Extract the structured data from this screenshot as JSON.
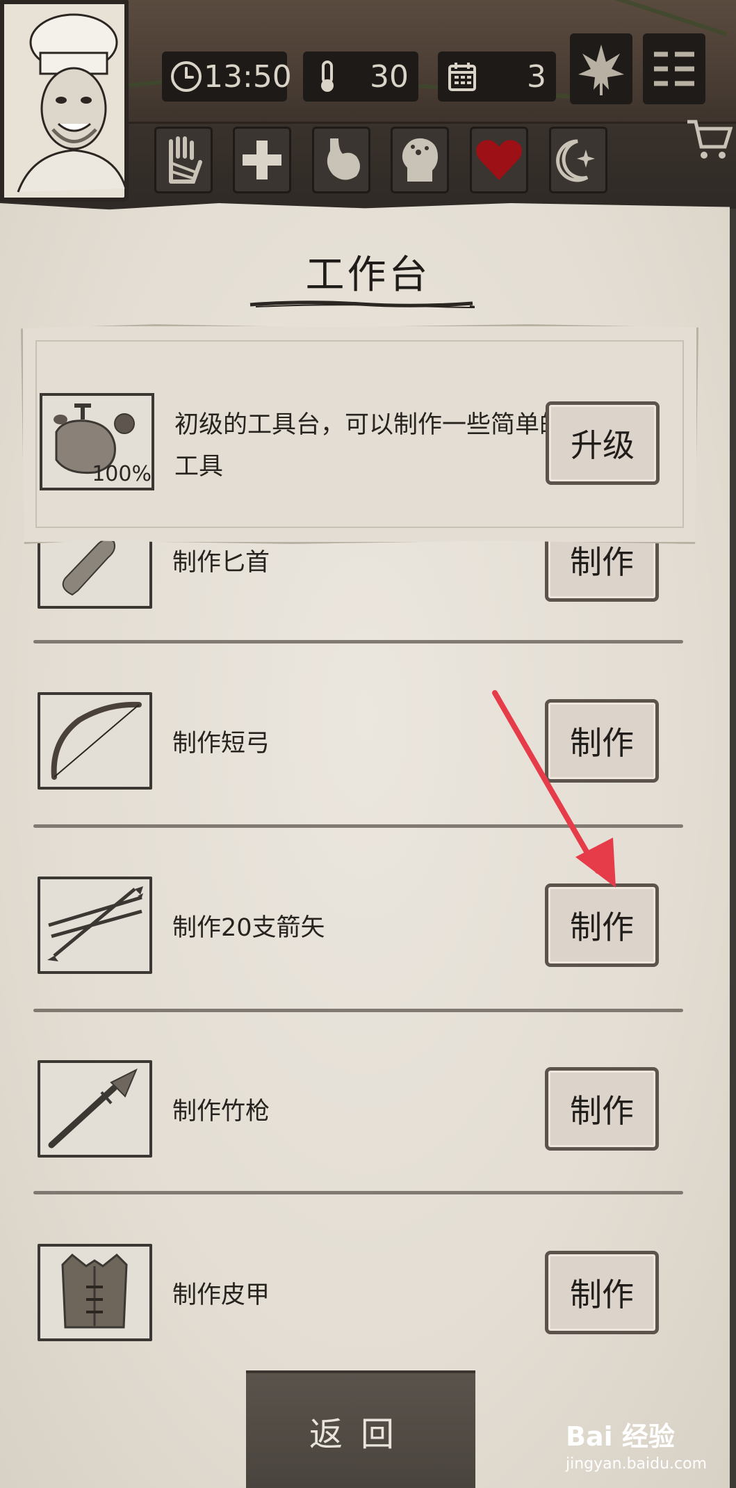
{
  "status": {
    "time": "13:50",
    "temperature": "30",
    "day": "3"
  },
  "icons": {
    "clock": "clock-icon",
    "thermometer": "thermometer-icon",
    "calendar": "calendar-icon",
    "leaf": "leaf-icon",
    "menu": "menu-icon",
    "cart": "cart-icon"
  },
  "status_buttons": [
    {
      "name": "hand-bandage-icon"
    },
    {
      "name": "medical-cross-icon"
    },
    {
      "name": "stomach-icon"
    },
    {
      "name": "head-mind-icon"
    },
    {
      "name": "heart-icon"
    },
    {
      "name": "moon-star-icon"
    }
  ],
  "panel": {
    "title": "工作台"
  },
  "header_card": {
    "description": "初级的工具台，可以制作一些简单的工具",
    "progress": "100%",
    "upgrade_label": "升级"
  },
  "recipes": [
    {
      "label": "制作匕首",
      "button": "制作"
    },
    {
      "label": "制作短弓",
      "button": "制作"
    },
    {
      "label": "制作20支箭矢",
      "button": "制作"
    },
    {
      "label": "制作竹枪",
      "button": "制作"
    },
    {
      "label": "制作皮甲",
      "button": "制作"
    }
  ],
  "footer": {
    "back_label": "返回"
  },
  "watermark": {
    "brand": "Bai 经验",
    "site": "jingyan.baidu.com"
  },
  "colors": {
    "parchment": "#e3ddd3",
    "button_face": "#dcd3ca",
    "heart": "#9c1016",
    "arrow": "#e63c4a"
  }
}
